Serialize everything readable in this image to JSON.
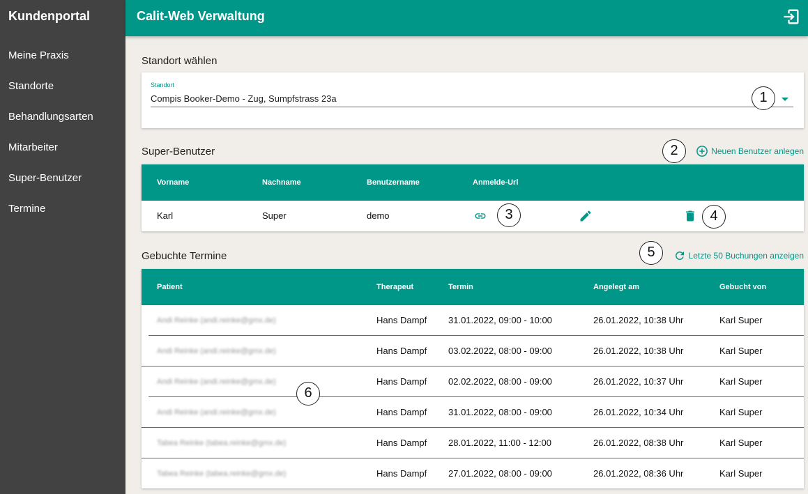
{
  "sidebar": {
    "title": "Kundenportal",
    "items": [
      {
        "label": "Meine Praxis"
      },
      {
        "label": "Standorte"
      },
      {
        "label": "Behandlungsarten"
      },
      {
        "label": "Mitarbeiter"
      },
      {
        "label": "Super-Benutzer"
      },
      {
        "label": "Termine"
      }
    ]
  },
  "header": {
    "title": "Calit-Web Verwaltung",
    "logout_icon": "logout-icon"
  },
  "standort": {
    "section_title": "Standort wählen",
    "field_label": "Standort",
    "field_value": "Compis Booker-Demo - Zug, Sumpfstrass 23a"
  },
  "superusers": {
    "section_title": "Super-Benutzer",
    "add_label": "Neuen Benutzer anlegen",
    "columns": [
      "Vorname",
      "Nachname",
      "Benutzername",
      "Anmelde-Url"
    ],
    "rows": [
      {
        "vorname": "Karl",
        "nachname": "Super",
        "benutzername": "demo"
      }
    ]
  },
  "termine": {
    "section_title": "Gebuchte Termine",
    "show_label": "Letzte 50 Buchungen anzeigen",
    "columns": [
      "Patient",
      "Therapeut",
      "Termin",
      "Angelegt am",
      "Gebucht von"
    ],
    "rows": [
      {
        "patient": "Andi Reinke (andi.reinke@gmx.de)",
        "therapeut": "Hans Dampf",
        "termin": "31.01.2022, 09:00 - 10:00",
        "angelegt": "26.01.2022, 10:38 Uhr",
        "gebucht_von": "Karl Super"
      },
      {
        "patient": "Andi Reinke (andi.reinke@gmx.de)",
        "therapeut": "Hans Dampf",
        "termin": "03.02.2022, 08:00 - 09:00",
        "angelegt": "26.01.2022, 10:38 Uhr",
        "gebucht_von": "Karl Super"
      },
      {
        "patient": "Andi Reinke (andi.reinke@gmx.de)",
        "therapeut": "Hans Dampf",
        "termin": "02.02.2022, 08:00 - 09:00",
        "angelegt": "26.01.2022, 10:37 Uhr",
        "gebucht_von": "Karl Super"
      },
      {
        "patient": "Andi Reinke (andi.reinke@gmx.de)",
        "therapeut": "Hans Dampf",
        "termin": "31.01.2022, 08:00 - 09:00",
        "angelegt": "26.01.2022, 10:34 Uhr",
        "gebucht_von": "Karl Super"
      },
      {
        "patient": "Tabea Reinke (tabea.reinke@gmx.de)",
        "therapeut": "Hans Dampf",
        "termin": "28.01.2022, 11:00 - 12:00",
        "angelegt": "26.01.2022, 08:38 Uhr",
        "gebucht_von": "Karl Super"
      },
      {
        "patient": "Tabea Reinke (tabea.reinke@gmx.de)",
        "therapeut": "Hans Dampf",
        "termin": "27.01.2022, 08:00 - 09:00",
        "angelegt": "26.01.2022, 08:36 Uhr",
        "gebucht_von": "Karl Super"
      }
    ]
  },
  "callouts": [
    "1",
    "2",
    "3",
    "4",
    "5",
    "6"
  ],
  "colors": {
    "accent": "#009688",
    "sidebar": "#424242",
    "background": "#f1eeea"
  }
}
